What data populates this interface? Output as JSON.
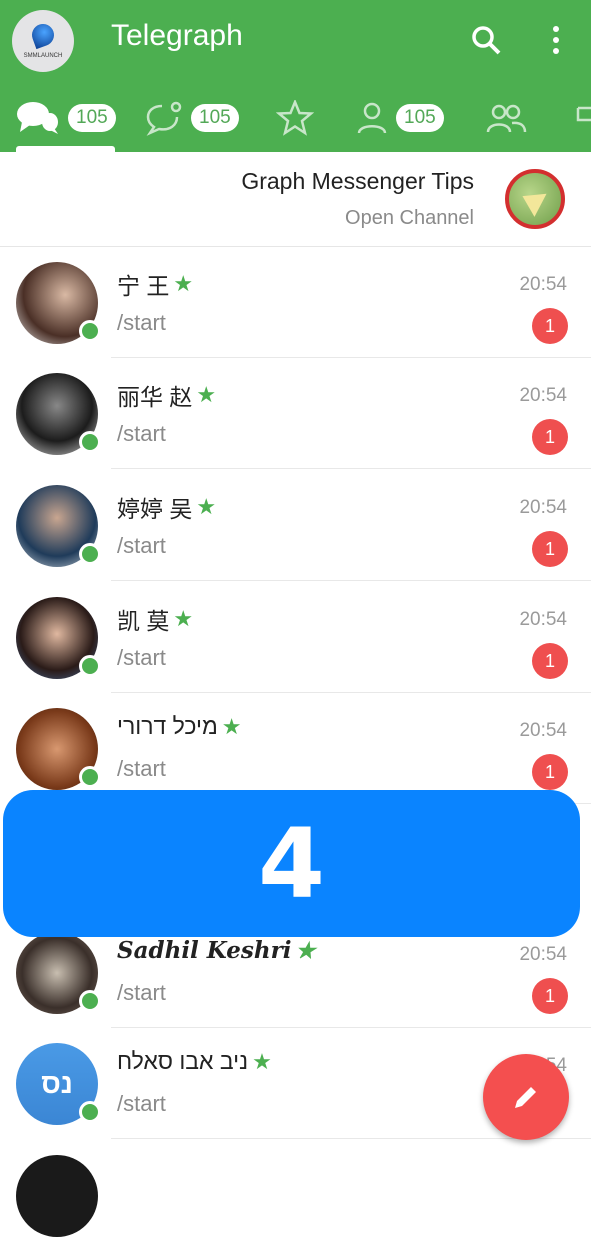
{
  "app": {
    "title": "Telegraph",
    "logo_text": "SMMLAUNCH"
  },
  "tabs": [
    {
      "icon": "chats-icon",
      "count": "105",
      "active": true
    },
    {
      "icon": "unread-chat-icon",
      "count": "105"
    },
    {
      "icon": "star-icon"
    },
    {
      "icon": "user-icon",
      "count": "105"
    },
    {
      "icon": "group-icon"
    },
    {
      "icon": "channel-icon"
    }
  ],
  "pinned": {
    "title": "Graph Messenger Tips",
    "subtitle": "Open Channel"
  },
  "chats": [
    {
      "name": "宁 王",
      "message": "/start",
      "time": "20:54",
      "unread": "1",
      "online": true
    },
    {
      "name": "丽华 赵",
      "message": "/start",
      "time": "20:54",
      "unread": "1",
      "online": true
    },
    {
      "name": "婷婷 吴",
      "message": "/start",
      "time": "20:54",
      "unread": "1",
      "online": true
    },
    {
      "name": "凯 莫",
      "message": "/start",
      "time": "20:54",
      "unread": "1",
      "online": true
    },
    {
      "name": "מיכל דרורי",
      "message": "/start",
      "time": "20:54",
      "unread": "1",
      "online": true
    },
    {
      "name": "Sadhil Keshri",
      "message": "/start",
      "time": "20:54",
      "unread": "1",
      "online": true
    },
    {
      "name": "ניב אבו סאלח",
      "initials": "נס",
      "message": "/start",
      "time": "20:54",
      "online": true
    }
  ],
  "overlay": {
    "label": "4"
  },
  "colors": {
    "primary": "#4caf50",
    "badge": "#ef4f4f",
    "overlay": "#0a84ff",
    "fab": "#f44f4f"
  }
}
